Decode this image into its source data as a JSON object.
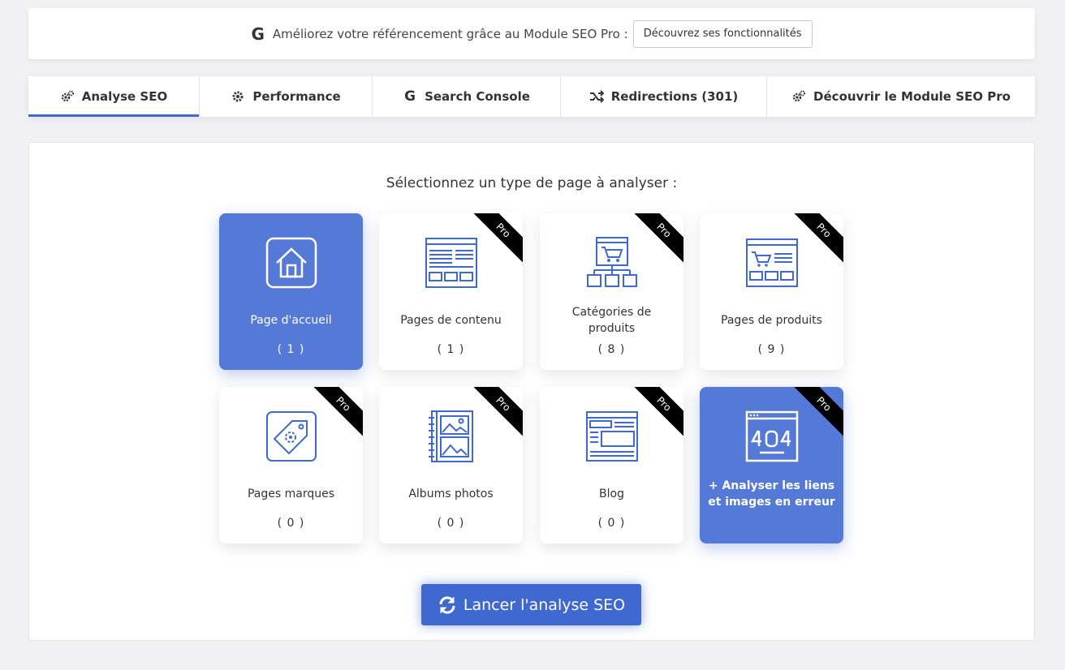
{
  "banner": {
    "icon": "google-g-icon",
    "g_letter": "G",
    "text": "Améliorez votre référencement grâce au Module SEO Pro :",
    "button": "Découvrez ses fonctionnalités"
  },
  "tabs": [
    {
      "label": "Analyse SEO",
      "icon": "gears-icon",
      "active": true
    },
    {
      "label": "Performance",
      "icon": "gear-icon",
      "active": false
    },
    {
      "label": "Search Console",
      "icon": "google-g-icon",
      "active": false
    },
    {
      "label": "Redirections (301)",
      "icon": "shuffle-icon",
      "active": false
    },
    {
      "label": "Découvrir le Module SEO Pro",
      "icon": "gears-icon",
      "active": false
    }
  ],
  "main": {
    "title": "Sélectionnez un type de page à analyser :",
    "ribbon_label": "Pro",
    "cards": [
      {
        "label": "Page d'accueil",
        "count": "( 1 )",
        "icon": "home-icon",
        "pro": false,
        "selected": true
      },
      {
        "label": "Pages de contenu",
        "count": "( 1 )",
        "icon": "content-page-icon",
        "pro": true,
        "selected": false
      },
      {
        "label": "Catégories de produits",
        "count": "( 8 )",
        "icon": "categories-icon",
        "pro": true,
        "selected": false
      },
      {
        "label": "Pages de produits",
        "count": "( 9 )",
        "icon": "product-page-icon",
        "pro": true,
        "selected": false
      },
      {
        "label": "Pages marques",
        "count": "( 0 )",
        "icon": "brand-tag-icon",
        "pro": true,
        "selected": false
      },
      {
        "label": "Albums photos",
        "count": "( 0 )",
        "icon": "photo-album-icon",
        "pro": true,
        "selected": false
      },
      {
        "label": "Blog",
        "count": "( 0 )",
        "icon": "blog-icon",
        "pro": true,
        "selected": false
      },
      {
        "label": "+ Analyser les liens et images en erreur",
        "count": "",
        "icon": "error-404-icon",
        "pro": true,
        "selected": true
      }
    ],
    "launch_button": "Lancer l'analyse SEO",
    "launch_icon": "refresh-icon"
  },
  "colors": {
    "accent": "#3f68d0",
    "card_selected": "#5479d6",
    "icon_stroke": "#3f68d0",
    "ribbon": "#000000"
  }
}
